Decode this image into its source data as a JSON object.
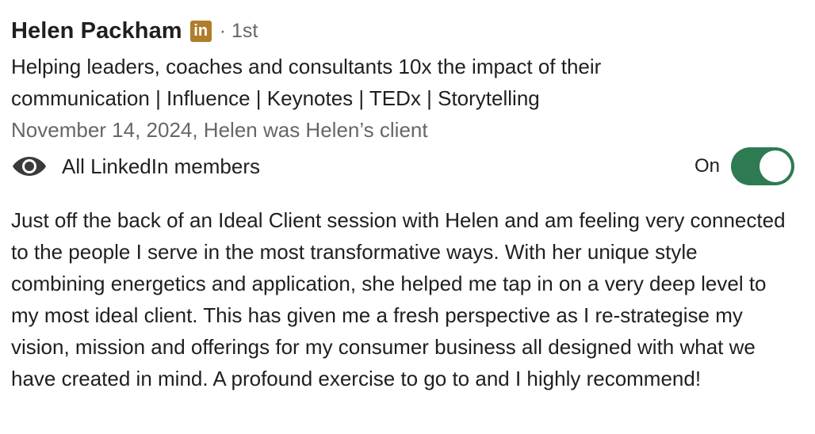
{
  "recommender": {
    "name": "Helen Packham",
    "network_badge": "in",
    "degree": "· 1st",
    "headline": "Helping leaders, coaches and consultants 10x the impact of their communication | Influence | Keynotes | TEDx | Storytelling",
    "relation": "November 14, 2024, Helen was Helen’s client"
  },
  "visibility": {
    "icon": "eye-icon",
    "label": "All LinkedIn members",
    "toggle_label": "On",
    "toggle_state": "on",
    "toggle_color": "#2e7a52"
  },
  "recommendation_text": "Just off the back of an Ideal Client session with Helen and am feeling very connected to the people I serve in the most transformative ways. With her unique style combining energetics and application, she helped me tap in on a very deep level to my most ideal client. This has given me a fresh perspective as I re-strategise my vision, mission and offerings for my consumer business all designed with what we have created in mind. A profound exercise to go to and I highly recommend!",
  "colors": {
    "badge": "#b07d2a",
    "muted_text": "#666666",
    "primary_text": "#1f1f1f"
  }
}
